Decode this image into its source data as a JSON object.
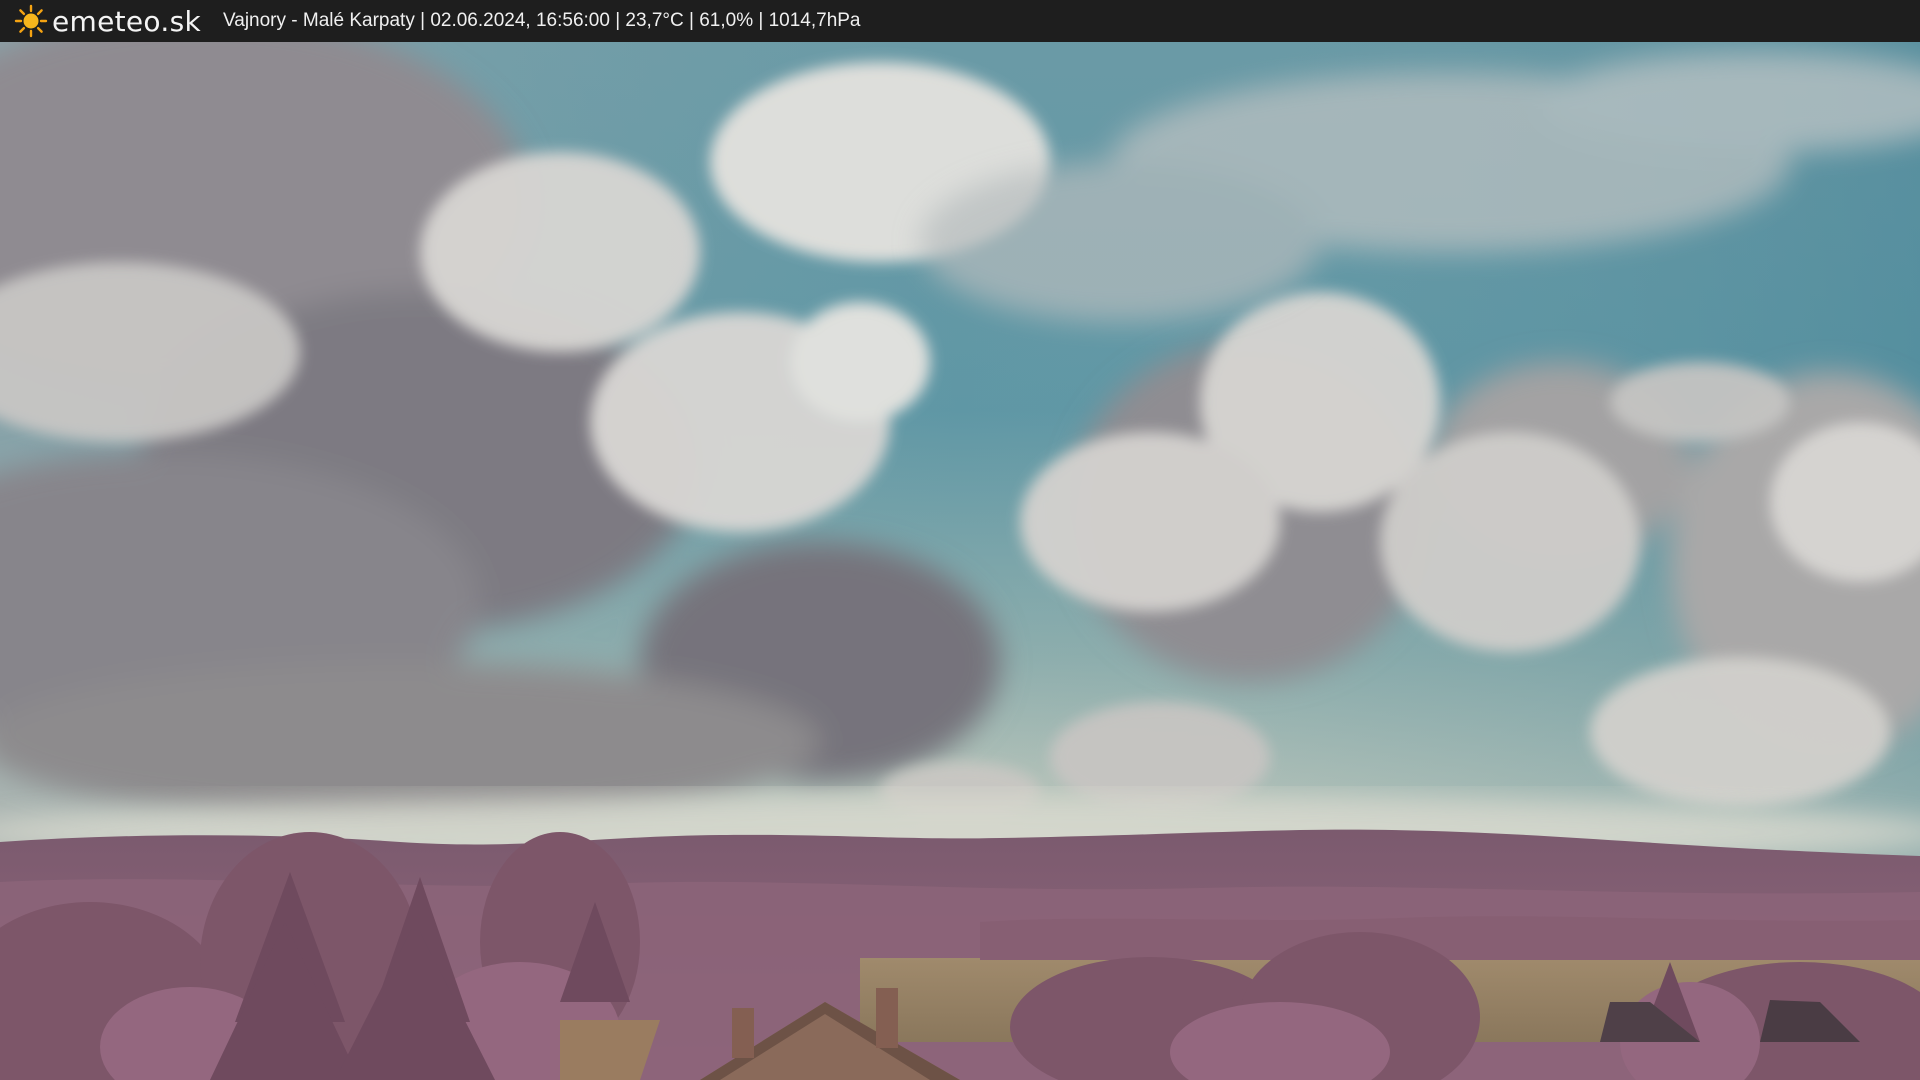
{
  "header": {
    "site_name": "emeteo.sk",
    "logo_icon": "sun-icon",
    "caption": "Vajnory - Malé Karpaty | 02.06.2024, 16:56:00 | 23,7°C | 61,0% | 1014,7hPa"
  },
  "colors": {
    "bar": "#1e1e1e",
    "sun": "#f5a312",
    "sky": "#5f98a6",
    "foliage": "#8a5d74"
  }
}
